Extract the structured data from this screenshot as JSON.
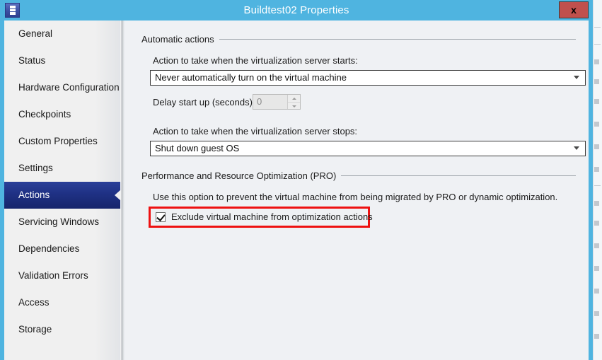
{
  "window": {
    "title": "Buildtest02 Properties",
    "app_icon": "properties-document-icon",
    "close_label": "x",
    "accent_color": "#4fb4e0",
    "selected_nav_color": "#1f3184",
    "highlight_color": "#ee1111"
  },
  "sidebar": {
    "items": [
      {
        "label": "General",
        "selected": false
      },
      {
        "label": "Status",
        "selected": false
      },
      {
        "label": "Hardware Configuration",
        "selected": false
      },
      {
        "label": "Checkpoints",
        "selected": false
      },
      {
        "label": "Custom Properties",
        "selected": false
      },
      {
        "label": "Settings",
        "selected": false
      },
      {
        "label": "Actions",
        "selected": true
      },
      {
        "label": "Servicing Windows",
        "selected": false
      },
      {
        "label": "Dependencies",
        "selected": false
      },
      {
        "label": "Validation Errors",
        "selected": false
      },
      {
        "label": "Access",
        "selected": false
      },
      {
        "label": "Storage",
        "selected": false
      }
    ]
  },
  "content": {
    "automatic_actions": {
      "group_title": "Automatic actions",
      "start_label": "Action to take when the virtualization server starts:",
      "start_value": "Never automatically turn on the virtual machine",
      "delay_label": "Delay start up (seconds):",
      "delay_value": "0",
      "delay_enabled": false,
      "stop_label": "Action to take when the virtualization server stops:",
      "stop_value": "Shut down guest OS"
    },
    "pro": {
      "group_title": "Performance and Resource Optimization (PRO)",
      "description": "Use this option to prevent the virtual machine from being migrated by PRO or dynamic optimization.",
      "checkbox_label": "Exclude virtual machine from optimization actions",
      "checkbox_checked": true
    }
  }
}
